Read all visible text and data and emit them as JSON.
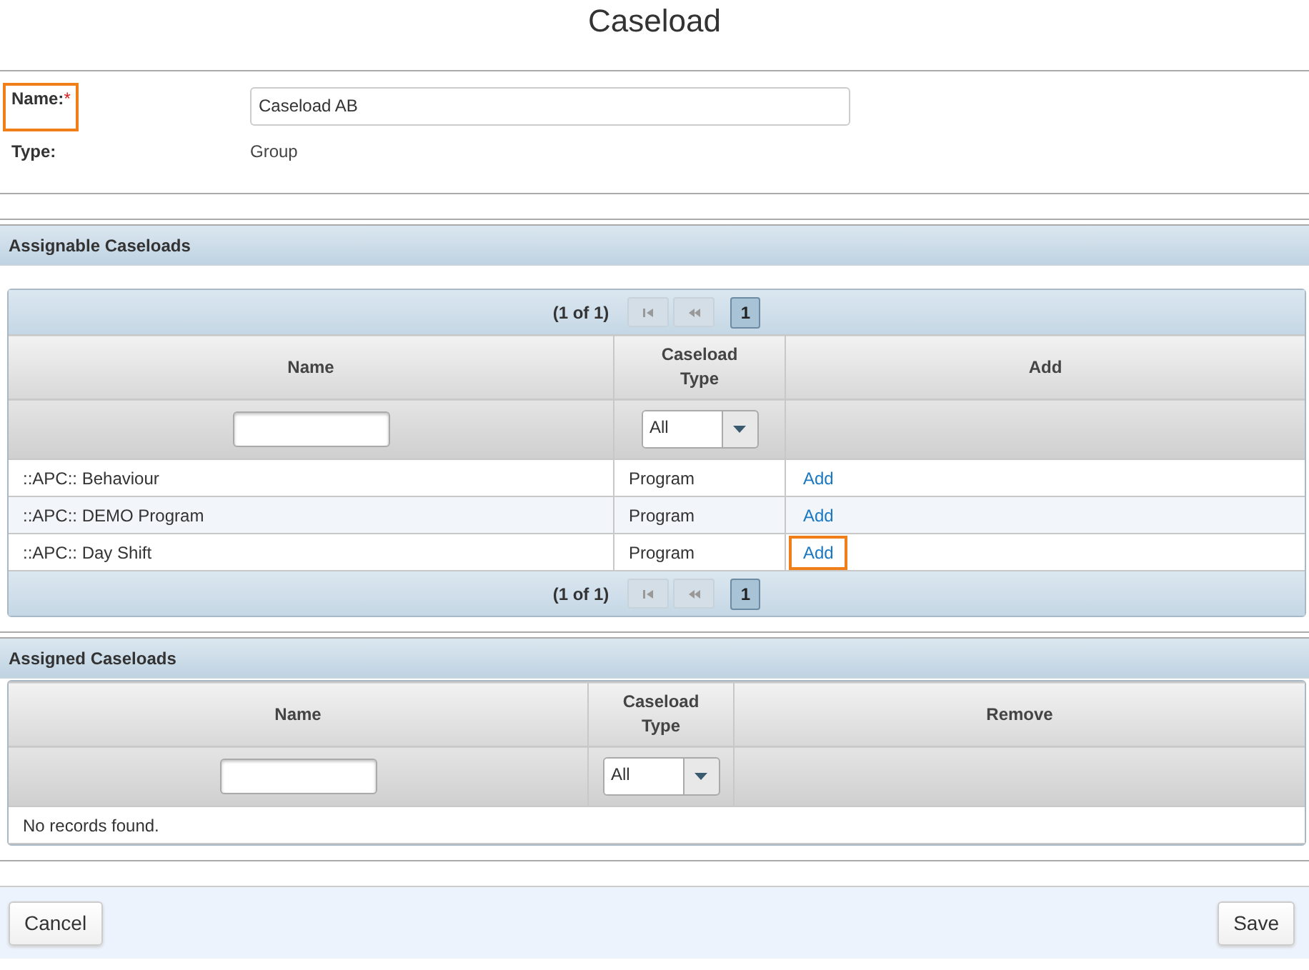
{
  "page_title": "Caseload",
  "form": {
    "fields": [
      {
        "kind": "input",
        "label": "Name:",
        "required_mark": "*",
        "highlighted": true,
        "value": "Caseload AB"
      },
      {
        "kind": "text",
        "label": "Type:",
        "highlighted": false,
        "value": "Group"
      }
    ]
  },
  "assignable": {
    "title": "Assignable Caseloads",
    "paginator": {
      "status": "(1 of 1)",
      "pages": [
        {
          "label": "1",
          "selected": true
        }
      ]
    },
    "columns": [
      "Name",
      "Caseload Type",
      "Add"
    ],
    "type_filter": "All",
    "rows": [
      {
        "name": "::APC:: Behaviour",
        "type": "Program",
        "action": "Add",
        "highlighted": false
      },
      {
        "name": "::APC:: DEMO Program",
        "type": "Program",
        "action": "Add",
        "highlighted": false
      },
      {
        "name": "::APC:: Day Shift",
        "type": "Program",
        "action": "Add",
        "highlighted": true
      }
    ],
    "bottom_paginator": {
      "status": "(1 of 1)",
      "pages": [
        {
          "label": "1",
          "selected": true
        }
      ]
    }
  },
  "assigned": {
    "title": "Assigned Caseloads",
    "columns": [
      "Name",
      "Caseload Type",
      "Remove"
    ],
    "type_filter": "All",
    "empty_message": "No records found."
  },
  "buttons": [
    "Cancel",
    "Save"
  ]
}
